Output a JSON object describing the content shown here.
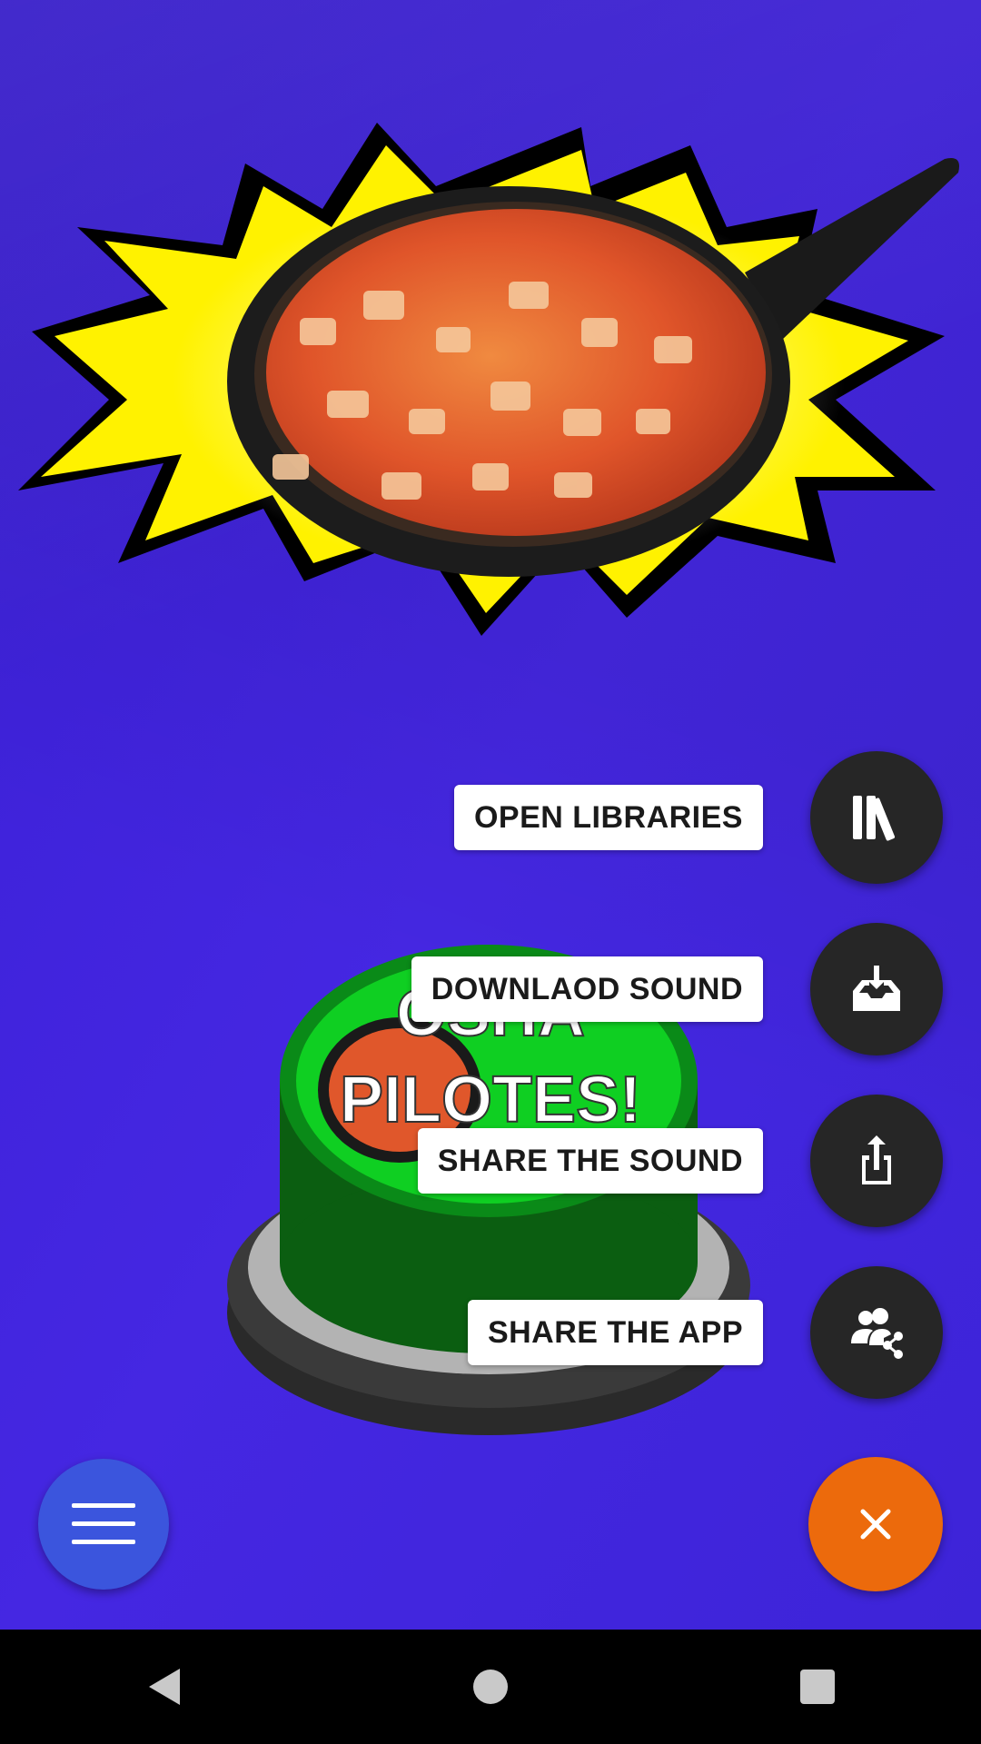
{
  "colors": {
    "background": "#3c22d6",
    "mini_fab": "#262626",
    "menu_fab": "#3b55dd",
    "close_fab": "#ec6a0c",
    "button_green": "#0fbf1f"
  },
  "hero": {
    "icon": "frying-pan-stew-image"
  },
  "big_button": {
    "text_line1": "OSHA",
    "text_line2": "PILOTES!",
    "icon": "green-sound-button"
  },
  "actions": [
    {
      "label": "OPEN LIBRARIES",
      "icon": "libraries-icon"
    },
    {
      "label": "DOWNLAOD SOUND",
      "icon": "download-tray-icon"
    },
    {
      "label": "SHARE THE SOUND",
      "icon": "share-upload-icon"
    },
    {
      "label": "SHARE THE APP",
      "icon": "share-people-icon"
    }
  ],
  "menu_button": {
    "icon": "hamburger-menu-icon"
  },
  "close_button": {
    "icon": "close-icon"
  },
  "navigation": {
    "back": "back-icon",
    "home": "home-icon",
    "recents": "recents-icon"
  }
}
